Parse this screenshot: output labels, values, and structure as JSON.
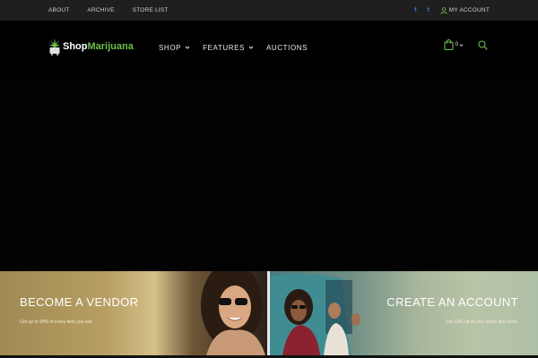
{
  "topbar": {
    "links": [
      "ABOUT",
      "ARCHIVE",
      "STORE LIST"
    ],
    "social": [
      {
        "icon": "facebook-icon",
        "glyph": "f"
      },
      {
        "icon": "twitter-icon",
        "glyph": "t"
      }
    ],
    "account_label": "MY ACCOUNT"
  },
  "header": {
    "logo": {
      "part1": "Shop",
      "part2": "Marijuana"
    },
    "nav": [
      {
        "label": "SHOP",
        "dropdown": true
      },
      {
        "label": "FEATURES",
        "dropdown": true
      },
      {
        "label": "AUCTIONS",
        "dropdown": false
      }
    ],
    "cart_count": "0"
  },
  "promos": {
    "vendor": {
      "title": "BECOME A VENDOR",
      "subtitle": "Get up to 90% of every item you sell."
    },
    "account": {
      "title": "CREATE AN ACCOUNT",
      "subtitle": "Get 10% off of your whole first order."
    }
  },
  "colors": {
    "brand_green": "#6cc14a",
    "topbar_bg": "#1f1f1f",
    "social_blue": "#3b78c4"
  }
}
